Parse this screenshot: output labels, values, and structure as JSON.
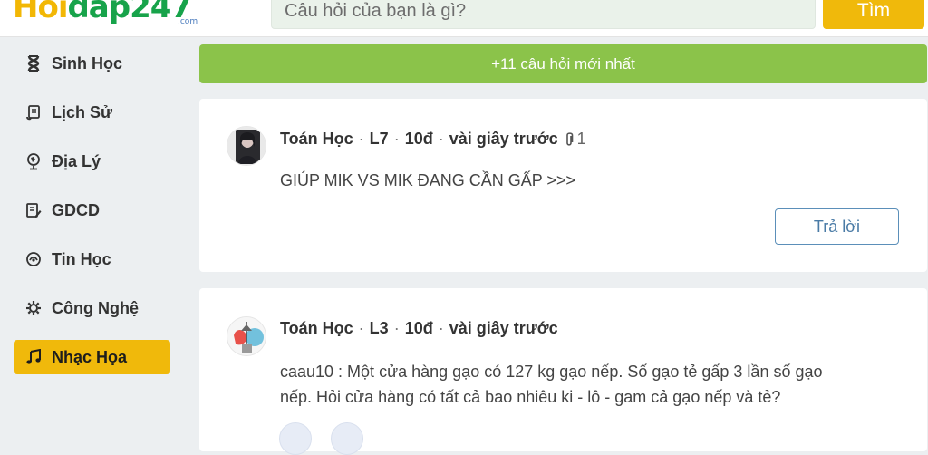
{
  "header": {
    "logo_part1": "Hoi",
    "logo_part2": "dap247",
    "logo_suffix": ".com",
    "search_placeholder": "Câu hỏi của bạn là gì?",
    "search_button": "Tìm"
  },
  "sidebar": {
    "items": [
      {
        "label": "Sinh Học",
        "icon": "dna-icon"
      },
      {
        "label": "Lịch Sử",
        "icon": "scroll-icon"
      },
      {
        "label": "Địa Lý",
        "icon": "globe-icon"
      },
      {
        "label": "GDCD",
        "icon": "book-edit-icon"
      },
      {
        "label": "Tin Học",
        "icon": "computer-icon"
      },
      {
        "label": "Công Nghệ",
        "icon": "gear-icon"
      },
      {
        "label": "Nhạc Họa",
        "icon": "music-note-icon",
        "active": true
      }
    ]
  },
  "banner": {
    "text": "+11 câu hỏi mới nhất"
  },
  "questions": [
    {
      "subject": "Toán Học",
      "grade": "L7",
      "points": "10đ",
      "time": "vài giây trước",
      "attachments": "1",
      "text": "GIÚP MIK VS MIK ĐANG CẦN GẤP >>>",
      "reply_label": "Trả lời"
    },
    {
      "subject": "Toán Học",
      "grade": "L3",
      "points": "10đ",
      "time": "vài giây trước",
      "text_line1": "caau10 : Một cửa hàng gạo có 127 kg gạo nếp. Số gạo tẻ gấp 3 lần số gạo",
      "text_line2": "nếp. Hỏi cửa hàng có tất cả bao nhiêu ki - lô - gam cả gạo nếp và tẻ?"
    }
  ],
  "colors": {
    "accent_yellow": "#f0b90b",
    "banner_green": "#8bc34a",
    "logo_green": "#17a34a",
    "reply_blue": "#5b8fb9"
  }
}
